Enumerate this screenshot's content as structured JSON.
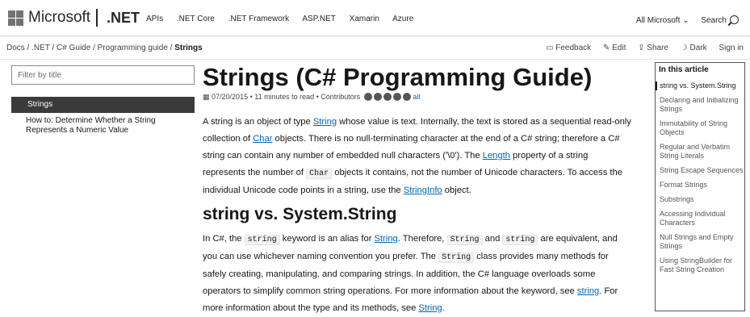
{
  "header": {
    "brand": "Microsoft",
    "product": ".NET",
    "nav": [
      "APIs",
      ".NET Core",
      ".NET Framework",
      "ASP.NET",
      "Xamarin",
      "Azure"
    ],
    "all_microsoft": "All Microsoft ⌄",
    "search_label": "Search"
  },
  "breadcrumb": {
    "path": "Docs / .NET / C# Guide / Programming guide /",
    "current": "Strings"
  },
  "actions": {
    "feedback": "Feedback",
    "edit": "Edit",
    "share": "Share",
    "dark": "Dark",
    "signin": "Sign in"
  },
  "sidebar": {
    "filter_placeholder": "Filter by title",
    "selected": "Strings",
    "child": "How to: Determine Whether a String Represents a Numeric Value"
  },
  "article": {
    "title": "Strings (C# Programming Guide)",
    "meta": "07/20/2015 • 11 minutes to read • Contributors",
    "meta_all": "all",
    "p1": {
      "t1": "A string is an object of type ",
      "l1": "String",
      "t2": " whose value is text. Internally, the text is stored as a sequential read-only collection of ",
      "l2": "Char",
      "t3": " objects. There is no null-terminating character at the end of a C# string; therefore a C# string can contain any number of embedded null characters ('\\0'). The ",
      "l3": "Length",
      "t4": " property of a string represents the number of ",
      "c1": "Char",
      "t5": " objects it contains, not the number of Unicode characters. To access the individual Unicode code points in a string, use the ",
      "l4": "StringInfo",
      "t6": " object."
    },
    "h2": "string vs. System.String",
    "p2": {
      "t1": "In C#, the ",
      "c1": "string",
      "t2": " keyword is an alias for ",
      "l1": "String",
      "t3": ". Therefore, ",
      "c2": "String",
      "t4": " and ",
      "c3": "string",
      "t5": " are equivalent, and you can use whichever naming convention you prefer. The ",
      "c4": "String",
      "t6": " class provides many methods for safely creating, manipulating, and comparing strings. In addition, the C# language overloads some operators to simplify common string operations. For more information about the keyword, see ",
      "l2": "string",
      "t7": ". For more information about the type and its methods, see ",
      "l3": "String",
      "t8": "."
    }
  },
  "toc": {
    "heading": "In this article",
    "items": [
      "string vs. System.String",
      "Declaring and Initializing Strings",
      "Immutability of String Objects",
      "Regular and Verbatim String Literals",
      "String Escape Sequences",
      "Format Strings",
      "Substrings",
      "Accessing Individual Characters",
      "Null Strings and Empty Strings",
      "Using StringBuilder for Fast String Creation"
    ]
  }
}
